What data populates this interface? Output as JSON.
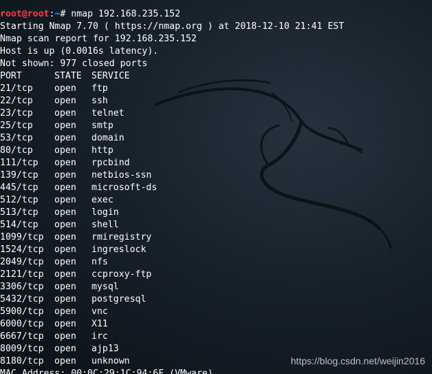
{
  "terminal": {
    "top_fragment": "                                                 ",
    "prompt": {
      "user_host": "root@root",
      "separator": ":",
      "path": "~",
      "symbol": "# ",
      "command": "nmap 192.168.235.152"
    },
    "header_lines": [
      "Starting Nmap 7.70 ( https://nmap.org ) at 2018-12-10 21:41 EST",
      "Nmap scan report for 192.168.235.152",
      "Host is up (0.0016s latency).",
      "Not shown: 977 closed ports"
    ],
    "table_header": {
      "port": "PORT",
      "state": "STATE",
      "service": "SERVICE"
    },
    "rows": [
      {
        "port": "21/tcp",
        "state": "open",
        "service": "ftp"
      },
      {
        "port": "22/tcp",
        "state": "open",
        "service": "ssh"
      },
      {
        "port": "23/tcp",
        "state": "open",
        "service": "telnet"
      },
      {
        "port": "25/tcp",
        "state": "open",
        "service": "smtp"
      },
      {
        "port": "53/tcp",
        "state": "open",
        "service": "domain"
      },
      {
        "port": "80/tcp",
        "state": "open",
        "service": "http"
      },
      {
        "port": "111/tcp",
        "state": "open",
        "service": "rpcbind"
      },
      {
        "port": "139/tcp",
        "state": "open",
        "service": "netbios-ssn"
      },
      {
        "port": "445/tcp",
        "state": "open",
        "service": "microsoft-ds"
      },
      {
        "port": "512/tcp",
        "state": "open",
        "service": "exec"
      },
      {
        "port": "513/tcp",
        "state": "open",
        "service": "login"
      },
      {
        "port": "514/tcp",
        "state": "open",
        "service": "shell"
      },
      {
        "port": "1099/tcp",
        "state": "open",
        "service": "rmiregistry"
      },
      {
        "port": "1524/tcp",
        "state": "open",
        "service": "ingreslock"
      },
      {
        "port": "2049/tcp",
        "state": "open",
        "service": "nfs"
      },
      {
        "port": "2121/tcp",
        "state": "open",
        "service": "ccproxy-ftp"
      },
      {
        "port": "3306/tcp",
        "state": "open",
        "service": "mysql"
      },
      {
        "port": "5432/tcp",
        "state": "open",
        "service": "postgresql"
      },
      {
        "port": "5900/tcp",
        "state": "open",
        "service": "vnc"
      },
      {
        "port": "6000/tcp",
        "state": "open",
        "service": "X11"
      },
      {
        "port": "6667/tcp",
        "state": "open",
        "service": "irc"
      },
      {
        "port": "8009/tcp",
        "state": "open",
        "service": "ajp13"
      },
      {
        "port": "8180/tcp",
        "state": "open",
        "service": "unknown"
      }
    ],
    "mac_line": "MAC Address: 00:0C:29:1C:94:6F (VMware)"
  },
  "watermark": "https://blog.csdn.net/weijin2016",
  "icons": {
    "background_logo": "kali-dragon-icon"
  },
  "colors": {
    "background": "#17212b",
    "text": "#ffffff",
    "prompt_user": "#ff3b3b",
    "prompt_path": "#5b8cff"
  }
}
